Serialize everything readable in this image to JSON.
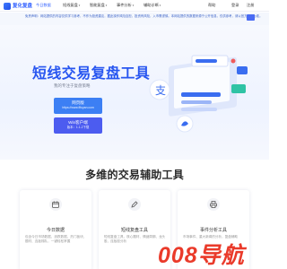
{
  "header": {
    "brand": "复化复盘",
    "nav": [
      {
        "label": "今日数据",
        "active": true
      },
      {
        "label": "短线复盘",
        "active": false
      },
      {
        "label": "智能复盘",
        "active": false
      },
      {
        "label": "事件分析",
        "active": false
      },
      {
        "label": "辅助诊断",
        "active": false
      }
    ],
    "help": "帮助",
    "login": "登录",
    "register": "注册"
  },
  "notice": {
    "text": "免责声明：网站提供的内容仅供学习参考，不作为投资建议，据此操作风险自担，投资有风险，入市需谨慎。本网站提供的数据来源于公开信息，仅供参考，请以官方发布为准。"
  },
  "hero": {
    "title": "短线交易复盘工具",
    "subtitle": "我的专注于复盘策略",
    "web_button": {
      "title": "网页版",
      "subtitle": "https://www.fifuyan.com"
    },
    "win_button": {
      "title": "Win客户端",
      "subtitle": "版本：1.1.2下载"
    }
  },
  "section": {
    "title": "多维的交易辅助工具",
    "cards": [
      {
        "title": "今日数据",
        "desc": "包含今日市场数据、涨跌数据、热门板块、题材、连板梯队，一键轻松掌握"
      },
      {
        "title": "短线复盘工具",
        "desc": "短线复盘工具，核心题材、情绪周期、龙头股、连板股分析"
      },
      {
        "title": "事件分析工具",
        "desc": "市场事件、重大新闻的分析，复盘辅助"
      }
    ]
  },
  "watermark": "008导航",
  "colors": {
    "primary": "#2f5fff",
    "accent": "#3c7ff4",
    "win": "#4c5cf0"
  }
}
